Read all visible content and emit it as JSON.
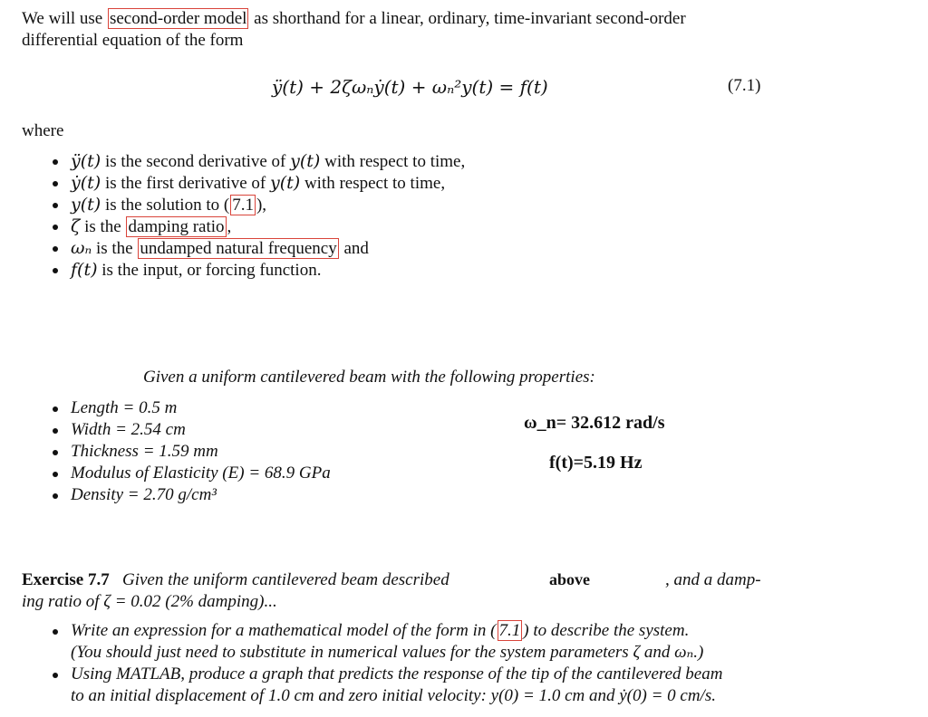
{
  "intro": {
    "line1_before": "We will use ",
    "line1_link": "second-order model",
    "line1_after": " as shorthand for a linear, ordinary, time-invariant second-order",
    "line2": "differential equation of the form"
  },
  "equation": {
    "text": "ÿ(t) + 2ζωₙẏ(t) + ωₙ²y(t) = f(t)",
    "number": "(7.1)"
  },
  "where_label": "where",
  "definitions": [
    {
      "symbol": "ÿ(t)",
      "text": " is the second derivative of ",
      "sym2": "y(t)",
      "text2": " with respect to time,"
    },
    {
      "symbol": "ẏ(t)",
      "text": " is the first derivative of ",
      "sym2": "y(t)",
      "text2": " with respect to time,"
    },
    {
      "symbol": "y(t)",
      "text": " is the solution to (",
      "link": "7.1",
      "text2": "),"
    },
    {
      "symbol": "ζ",
      "text": " is the ",
      "link": "damping ratio",
      "text2": ","
    },
    {
      "symbol": "ωₙ",
      "text": " is the ",
      "link": "undamped natural frequency",
      "text2": " and"
    },
    {
      "symbol": "f(t)",
      "text": " is the input, or forcing function."
    }
  ],
  "beam": {
    "title": "Given a uniform cantilevered beam with the following properties:",
    "properties": [
      {
        "label": "Length",
        "value": "0.5 m"
      },
      {
        "label": "Width",
        "value": "2.54 cm"
      },
      {
        "label": "Thickness",
        "value": "1.59 mm"
      },
      {
        "label": "Modulus of Elasticity (E)",
        "value": "68.9 GPa"
      },
      {
        "label": "Density",
        "value": "2.70 g/cm³"
      }
    ],
    "omega_n": "ω_n= 32.612 rad/s",
    "f_t": "f(t)=5.19 Hz"
  },
  "exercise": {
    "label": "Exercise 7.7",
    "text1": "Given the uniform cantilevered beam described",
    "inserted": "above",
    "text2": ", and a damp-",
    "line2": "ing ratio of ζ = 0.02 (2% damping)...",
    "tasks": [
      {
        "line1_before": "Write an expression for a mathematical model of the form in (",
        "link": "7.1",
        "line1_after": ") to describe the system.",
        "line2": "(You should just need to substitute in numerical values for the system parameters ζ and ωₙ.)"
      },
      {
        "line1": "Using MATLAB, produce a graph that predicts the response of the tip of the cantilevered beam",
        "line2": "to an initial displacement of 1.0 cm and zero initial velocity: y(0) = 1.0 cm and ẏ(0) = 0 cm/s."
      }
    ]
  },
  "colors": {
    "link_box": "#d9443a",
    "text": "#111111"
  }
}
